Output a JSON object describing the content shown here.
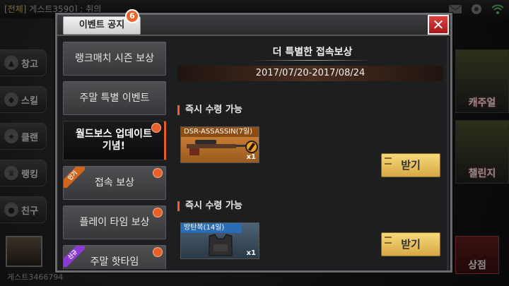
{
  "background": {
    "chat_tag": "[전체]",
    "chat_text": " 게스트3590] : 취의",
    "left_menu": [
      {
        "label": "창고",
        "icon": "pistol-icon"
      },
      {
        "label": "스킬",
        "icon": "skill-icon"
      },
      {
        "label": "클랜",
        "icon": "clan-star-icon"
      },
      {
        "label": "랭킹",
        "icon": "trophy-icon"
      },
      {
        "label": "친구",
        "icon": "friends-icon"
      }
    ],
    "player_name": "게스트3466794",
    "right_menu": [
      {
        "label": "캐주얼"
      },
      {
        "label": "챌린지"
      }
    ],
    "shop_label": "상점"
  },
  "dialog": {
    "tab_title": "이벤트 공지",
    "badge_count": "6",
    "close_symbol": "✕",
    "sidebar": [
      {
        "label": "랭크매치 시즌 보상",
        "dot": false,
        "ribbon": null,
        "active": false
      },
      {
        "label": "주말 특별 이벤트",
        "dot": false,
        "ribbon": null,
        "active": false
      },
      {
        "label": "월드보스 업데이트 기념!",
        "dot": true,
        "ribbon": null,
        "active": true
      },
      {
        "label": "접속 보상",
        "dot": true,
        "ribbon": "hot",
        "active": false
      },
      {
        "label": "플레이 타임 보상",
        "dot": true,
        "ribbon": null,
        "active": false
      },
      {
        "label": "주말 핫타임",
        "dot": true,
        "ribbon": "new",
        "active": false
      }
    ],
    "ribbons": {
      "hot": "인기",
      "new": "신규"
    },
    "content": {
      "title": "더 특별한 접속보상",
      "date_range": "2017/07/20-2017/08/24",
      "rewards": [
        {
          "section_label": "즉시 수령 가능",
          "item_name": "DSR-ASSASSIN(7일)",
          "qty": "x1",
          "style": "gold",
          "claim_label": "받기"
        },
        {
          "section_label": "즉시 수령 가능",
          "item_name": "방탄복(14일)",
          "qty": "x1",
          "style": "blue",
          "claim_label": "받기"
        }
      ]
    }
  }
}
